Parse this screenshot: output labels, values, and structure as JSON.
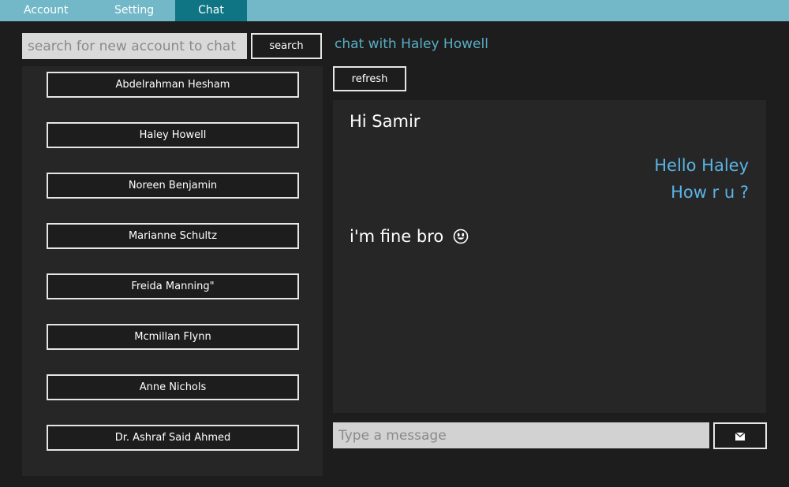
{
  "tabs": [
    {
      "label": "Account"
    },
    {
      "label": "Setting"
    },
    {
      "label": "Chat",
      "active": true
    }
  ],
  "search": {
    "placeholder": "search for new account to chat",
    "button_label": "search"
  },
  "contacts": [
    "Abdelrahman Hesham",
    "Haley Howell",
    "Noreen Benjamin",
    "Marianne Schultz",
    "Freida Manning\"",
    "Mcmillan Flynn",
    "Anne Nichols",
    "Dr. Ashraf Said Ahmed"
  ],
  "chat": {
    "title": "chat with Haley Howell",
    "refresh_label": "refresh",
    "messages": [
      {
        "direction": "in",
        "text": "Hi Samir"
      },
      {
        "direction": "out",
        "text": "Hello Haley"
      },
      {
        "direction": "out",
        "text": "How r u ?"
      },
      {
        "direction": "in",
        "text": "i'm fine bro",
        "emoji": "smiley-face-icon"
      }
    ],
    "input_placeholder": "Type a message",
    "send_icon": "envelope-icon"
  },
  "colors": {
    "tab_bar": "#72b8c8",
    "tab_active": "#0f7585",
    "accent_title": "#58aec4",
    "outgoing_message": "#5ab4e6",
    "background": "#1d1d1d",
    "panel": "#262626"
  }
}
